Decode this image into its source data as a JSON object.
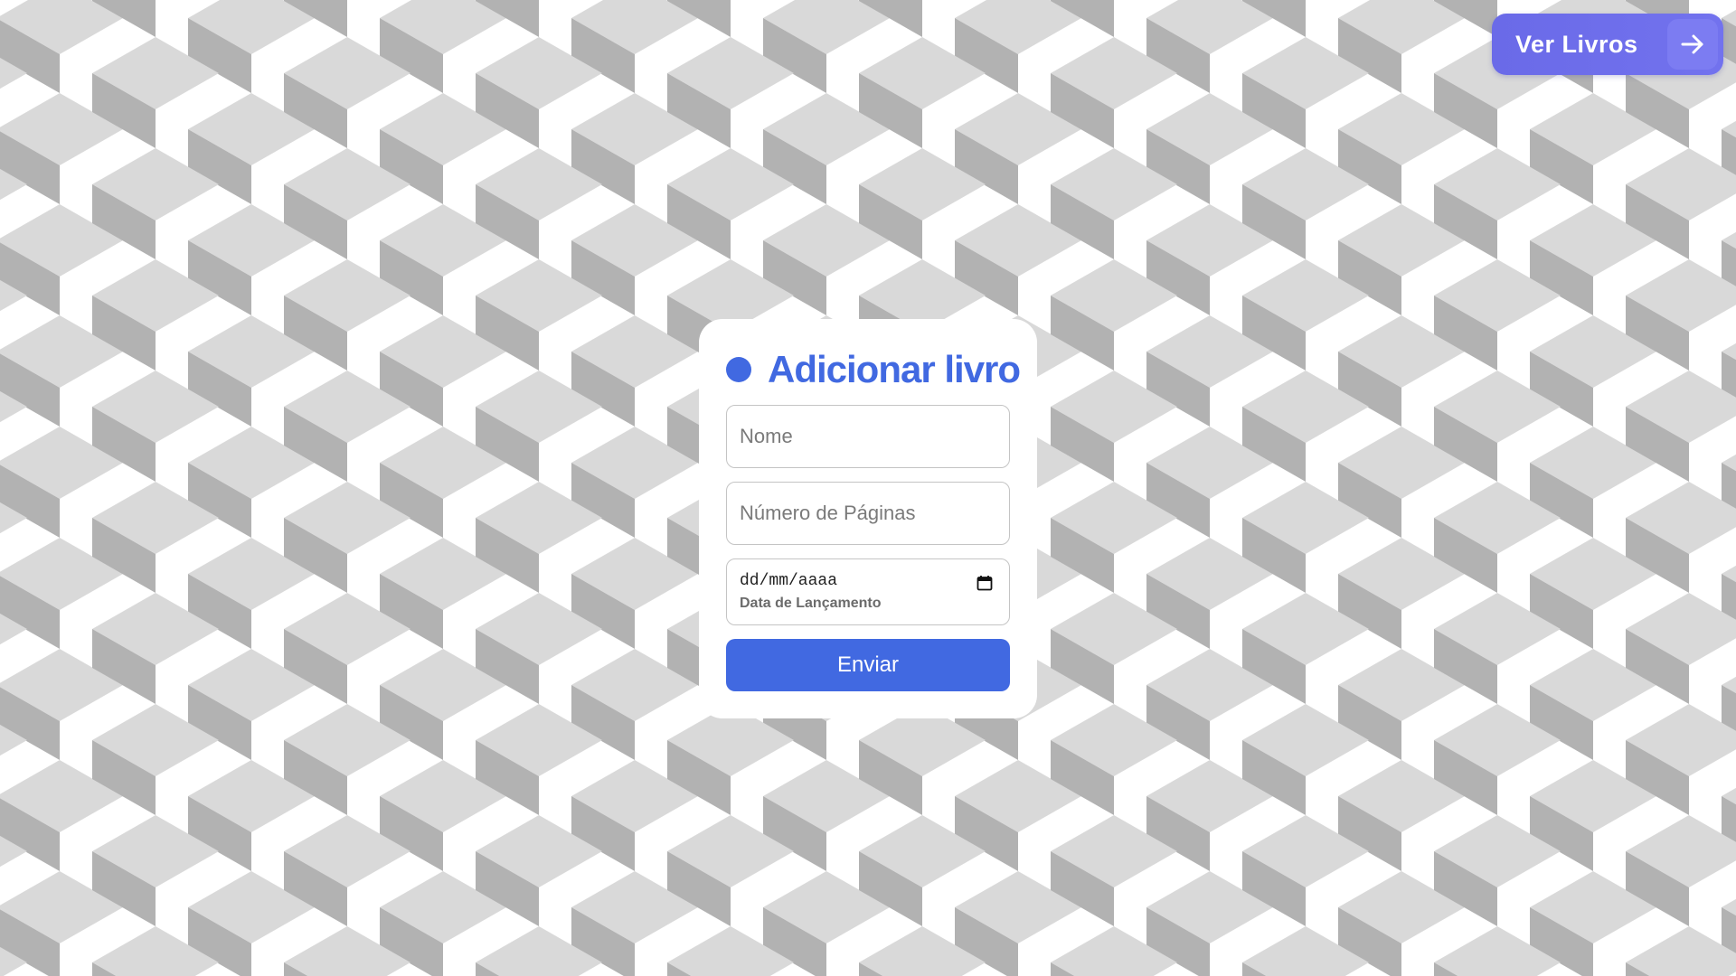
{
  "nav": {
    "ver_livros_label": "Ver Livros",
    "arrow_icon": "arrow-right-icon"
  },
  "form": {
    "title": "Adicionar livro",
    "title_icon": "dot-icon",
    "nome_placeholder": "Nome",
    "paginas_placeholder": "Número de Páginas",
    "data_value": "dd/mm/aaaa",
    "data_label": "Data de Lançamento",
    "calendar_icon": "calendar-icon",
    "submit_label": "Enviar"
  },
  "colors": {
    "accent": "#4169e1",
    "nav_button": "#6a6ae8",
    "pattern_light": "#d9d9d9",
    "pattern_dark": "#b2b2b2",
    "pattern_white": "#ffffff"
  }
}
